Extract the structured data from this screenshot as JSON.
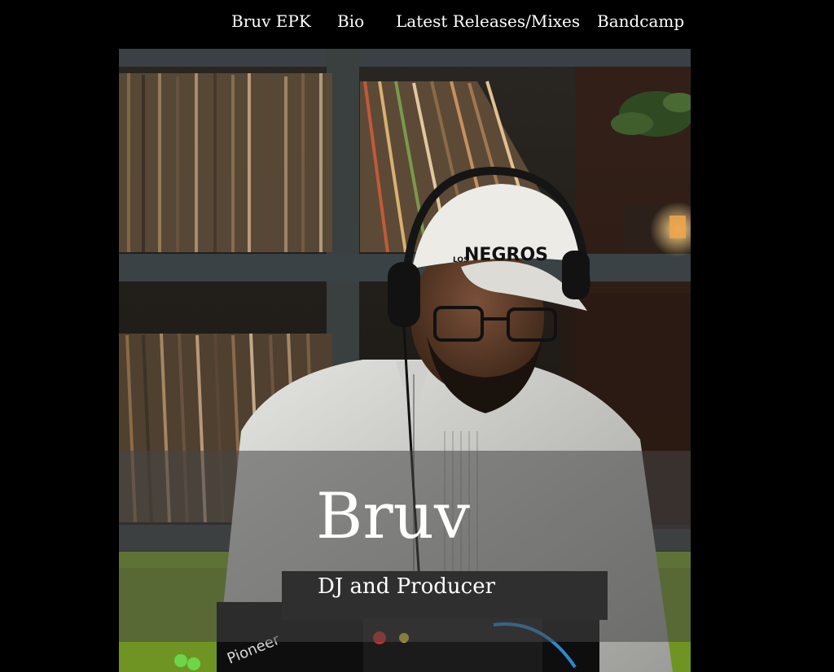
{
  "nav": {
    "items": [
      {
        "label": "Bruv EPK"
      },
      {
        "label": "Bio"
      },
      {
        "label": "Latest Releases/Mixes"
      },
      {
        "label": "Bandcamp"
      }
    ]
  },
  "hero": {
    "title": "Bruv",
    "subtitle": "DJ and Producer",
    "cap_text": "NEGROS",
    "cap_small_text": "LOS",
    "mixer_brand": "Pioneer"
  },
  "colors": {
    "background": "#000000",
    "text": "#ffffff",
    "overlay_band": "#464646",
    "shelf": "#3a4044",
    "accent_green": "#7fa825"
  }
}
